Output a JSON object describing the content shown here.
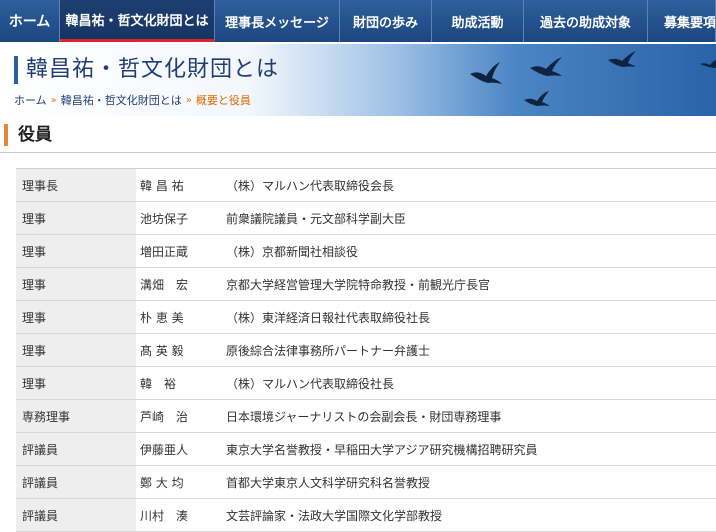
{
  "nav": {
    "items": [
      {
        "label": "ホーム"
      },
      {
        "label": "韓昌祐・哲文化財団とは"
      },
      {
        "label": "理事長メッセージ"
      },
      {
        "label": "財団の歩み"
      },
      {
        "label": "助成活動"
      },
      {
        "label": "過去の助成対象"
      },
      {
        "label": "募集要項"
      }
    ]
  },
  "header": {
    "title": "韓昌祐・哲文化財団とは",
    "breadcrumb": {
      "home": "ホーム",
      "parent": "韓昌祐・哲文化財団とは",
      "current": "概要と役員",
      "separator": "»"
    }
  },
  "section": {
    "title": "役員"
  },
  "officers": [
    {
      "title": "理事長",
      "name": "韓 昌 祐",
      "position": "（株）マルハン代表取締役会長"
    },
    {
      "title": "理事",
      "name": "池坊保子",
      "position": "前衆議院議員・元文部科学副大臣"
    },
    {
      "title": "理事",
      "name": "増田正蔵",
      "position": "（株）京都新聞社相談役"
    },
    {
      "title": "理事",
      "name": "溝畑　宏",
      "position": "京都大学経営管理大学院特命教授・前観光庁長官"
    },
    {
      "title": "理事",
      "name": "朴 恵 美",
      "position": "（株）東洋経済日報社代表取締役社長"
    },
    {
      "title": "理事",
      "name": "髙 英 毅",
      "position": "原後綜合法律事務所パートナー弁護士"
    },
    {
      "title": "理事",
      "name": "韓　裕",
      "position": "（株）マルハン代表取締役社長"
    },
    {
      "title": "専務理事",
      "name": "芦崎　治",
      "position": "日本環境ジャーナリストの会副会長・財団専務理事"
    },
    {
      "title": "評議員",
      "name": "伊藤亜人",
      "position": "東京大学名誉教授・早稲田大学アジア研究機構招聘研究員"
    },
    {
      "title": "評議員",
      "name": "鄭 大 均",
      "position": "首都大学東京人文科学研究科名誉教授"
    },
    {
      "title": "評議員",
      "name": "川村　湊",
      "position": "文芸評論家・法政大学国際文化学部教授"
    }
  ]
}
